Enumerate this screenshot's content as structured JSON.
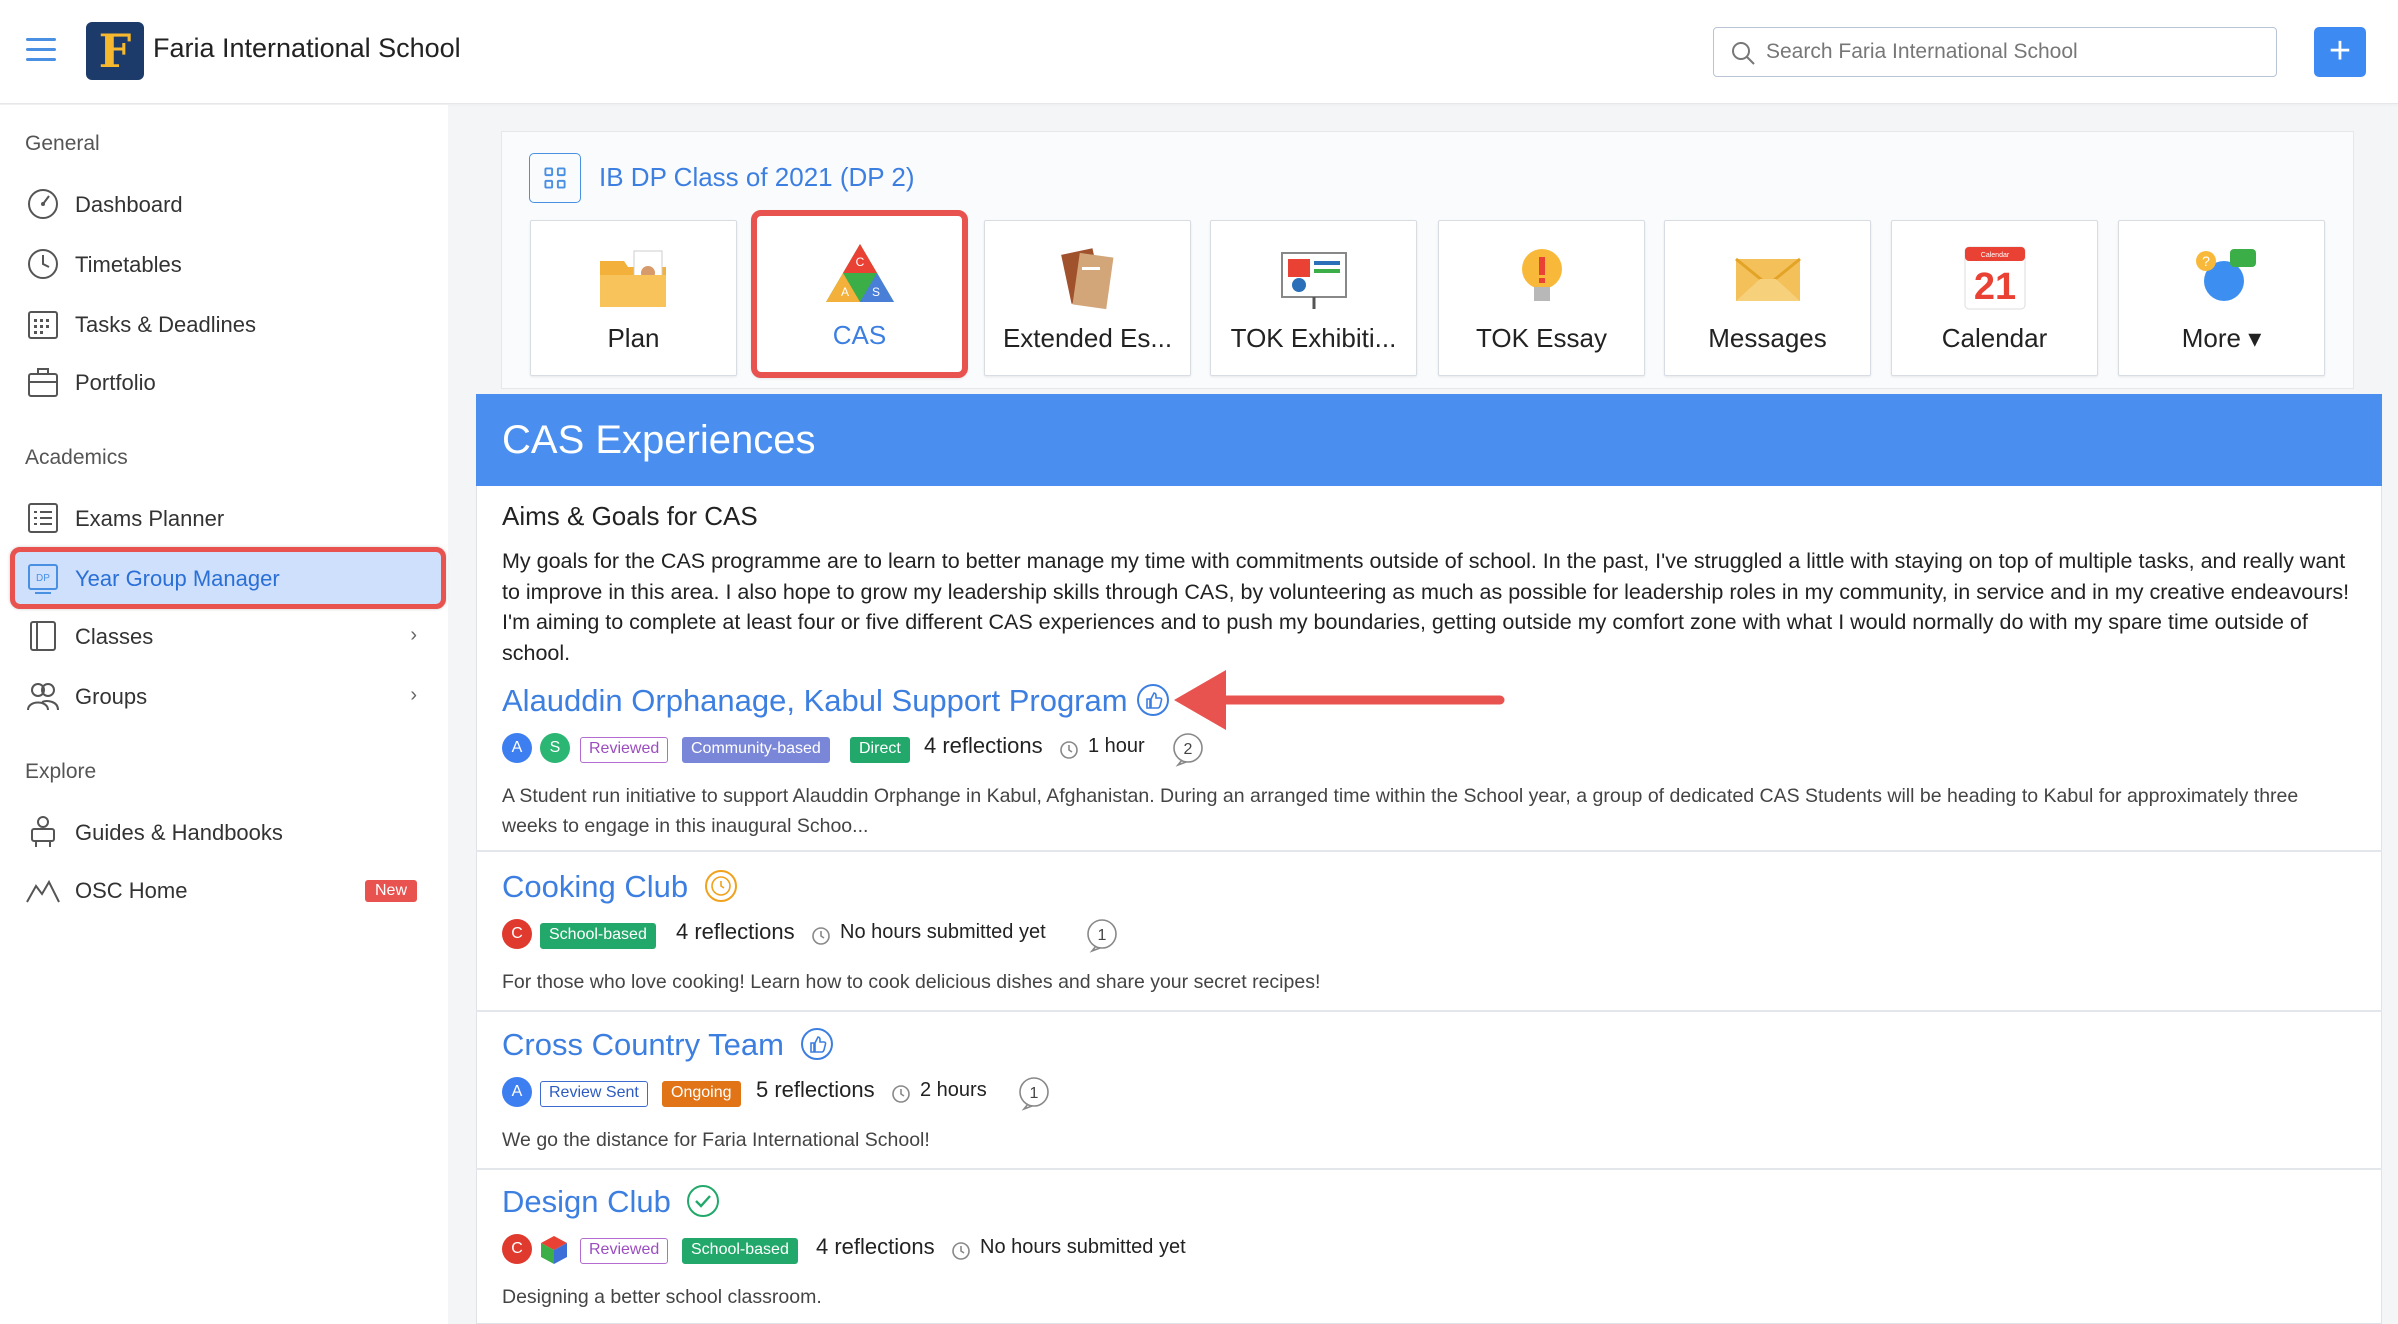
{
  "header": {
    "school_name": "Faria International School",
    "logo_letter": "F",
    "search_placeholder": "Search Faria International School",
    "plus_label": "+"
  },
  "sidebar": {
    "sections": [
      {
        "label": "General"
      },
      {
        "label": "Academics"
      },
      {
        "label": "Explore"
      }
    ],
    "items": [
      {
        "label": "Dashboard",
        "icon": "dashboard-gauge-icon"
      },
      {
        "label": "Timetables",
        "icon": "clock-icon"
      },
      {
        "label": "Tasks & Deadlines",
        "icon": "calendar-grid-icon"
      },
      {
        "label": "Portfolio",
        "icon": "briefcase-icon"
      },
      {
        "label": "Exams Planner",
        "icon": "list-icon"
      },
      {
        "label": "Year Group Manager",
        "icon": "dp-badge-icon",
        "icon_text": "DP"
      },
      {
        "label": "Classes",
        "icon": "book-icon"
      },
      {
        "label": "Groups",
        "icon": "people-icon"
      },
      {
        "label": "Guides & Handbooks",
        "icon": "guide-people-icon"
      },
      {
        "label": "OSC Home",
        "icon": "mountain-icon",
        "badge": "New"
      }
    ]
  },
  "class": {
    "title": "IB DP Class of 2021 (DP 2)",
    "tiles": [
      {
        "label": "Plan"
      },
      {
        "label": "CAS"
      },
      {
        "label": "Extended Es..."
      },
      {
        "label": "TOK Exhibiti..."
      },
      {
        "label": "TOK Essay"
      },
      {
        "label": "Messages"
      },
      {
        "label": "Calendar",
        "calendar_day": "21",
        "calendar_month": "Calendar"
      },
      {
        "label": "More ▾"
      }
    ],
    "cas_letters": [
      "C",
      "A",
      "S"
    ]
  },
  "cas": {
    "header": "CAS Experiences",
    "aims_title": "Aims & Goals for CAS",
    "aims_text": "My goals for the CAS programme are to learn to better manage my time with commitments outside of school. In the past, I've struggled a little with staying on top of multiple tasks, and really want to improve in this area. I also hope to grow my leadership skills through CAS, by volunteering as much as possible for leadership roles in my community, in service and in my creative endeavours! I'm aiming to complete at least four or five different CAS experiences and to push my boundaries, getting outside my comfort zone with what I would normally do with my spare time outside of school.",
    "experiences": [
      {
        "title": "Alauddin Orphanage, Kabul Support Program",
        "status_icon": "thumbs-up-icon",
        "avatars": [
          "A",
          "S"
        ],
        "tags": [
          "Reviewed",
          "Community-based",
          "Direct"
        ],
        "reflections": "4 reflections",
        "hours": "1 hour",
        "comments": "2",
        "description": "A Student run initiative to support Alauddin Orphange in Kabul, Afghanistan. During an arranged time within the School year, a group of dedicated CAS Students will be heading to Kabul for approximately three weeks to engage in this inaugural Schoo..."
      },
      {
        "title": "Cooking Club",
        "status_icon": "pending-clock-icon",
        "avatars": [
          "C"
        ],
        "tags": [
          "School-based"
        ],
        "reflections": "4 reflections",
        "hours": "No hours submitted yet",
        "comments": "1",
        "description": "For those who love cooking! Learn how to cook delicious dishes and share your secret recipes!"
      },
      {
        "title": "Cross Country Team",
        "status_icon": "thumbs-up-icon",
        "avatars": [
          "A"
        ],
        "tags": [
          "Review Sent",
          "Ongoing"
        ],
        "reflections": "5 reflections",
        "hours": "2 hours",
        "comments": "1",
        "description": "We go the distance for Faria International School!"
      },
      {
        "title": "Design Club",
        "status_icon": "check-circle-icon",
        "avatars": [
          "C"
        ],
        "tags": [
          "Reviewed",
          "School-based"
        ],
        "reflections": "4 reflections",
        "hours": "No hours submitted yet",
        "description": "Designing a better school classroom."
      }
    ]
  },
  "colors": {
    "accent": "#3d7fe0",
    "header_blue": "#4a8ff0",
    "highlight_red": "#e8524f",
    "avatar_blue": "#3d7ff0",
    "avatar_green": "#2bb673",
    "avatar_red": "#e03a2f"
  }
}
